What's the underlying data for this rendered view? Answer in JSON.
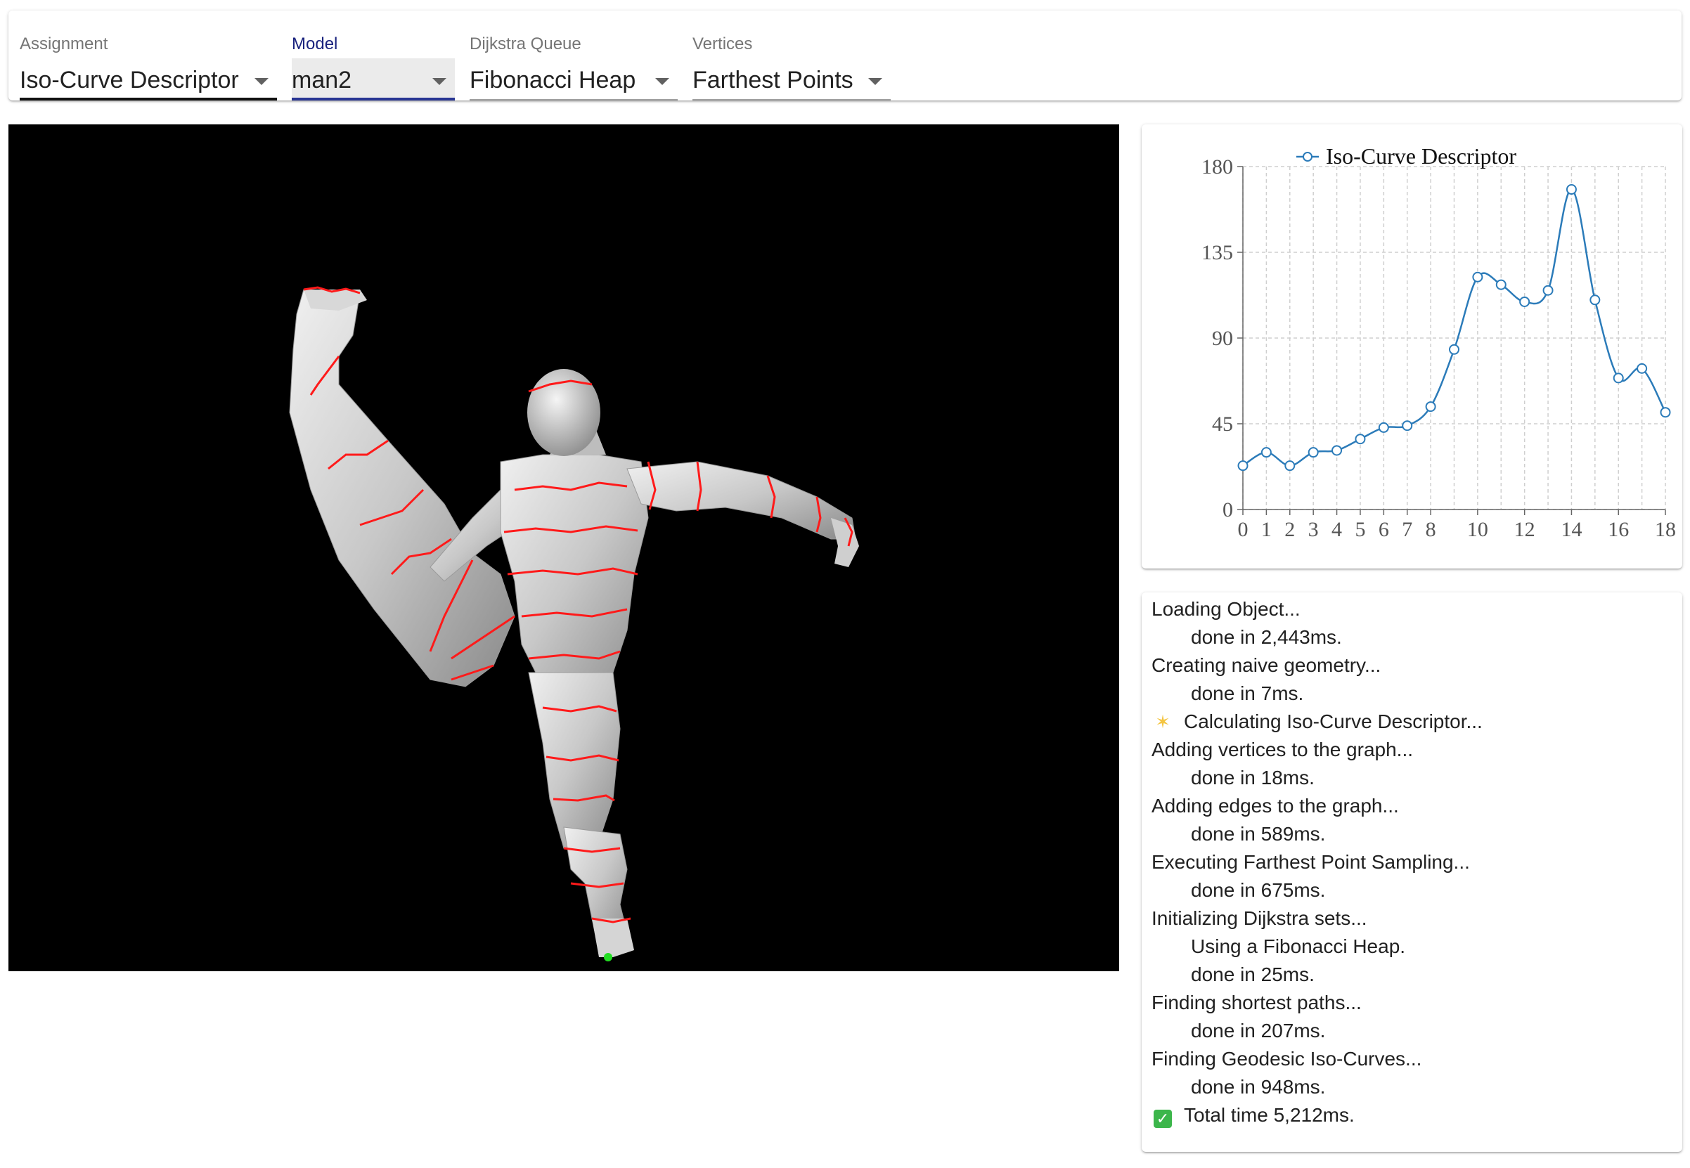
{
  "toolbar": {
    "assignment": {
      "label": "Assignment",
      "value": "Iso-Curve Descriptor"
    },
    "model": {
      "label": "Model",
      "value": "man2"
    },
    "queue": {
      "label": "Dijkstra Queue",
      "value": "Fibonacci Heap"
    },
    "vertices": {
      "label": "Vertices",
      "value": "Farthest Points"
    }
  },
  "viewport": {
    "background": "#000000",
    "mesh_color": "#d9d9d9",
    "curve_color": "#ff1a1a",
    "source_point_color": "#22dd22",
    "model_name": "man2"
  },
  "chart_data": {
    "type": "line",
    "series": [
      {
        "name": "Iso-Curve Descriptor",
        "color": "#2b7bb9",
        "x": [
          0,
          1,
          2,
          3,
          4,
          5,
          6,
          7,
          8,
          9,
          10,
          11,
          12,
          13,
          14,
          15,
          16,
          17,
          18
        ],
        "y": [
          23,
          30,
          23,
          30,
          31,
          37,
          43,
          44,
          54,
          84,
          122,
          118,
          109,
          115,
          168,
          110,
          69,
          74,
          51
        ]
      }
    ],
    "legend_position": "top",
    "grid": true,
    "xlim": [
      0,
      18
    ],
    "ylim": [
      0,
      180
    ],
    "x_ticks": [
      "0",
      "1",
      "2",
      "3",
      "4",
      "5",
      "6",
      "7",
      "8",
      "10",
      "12",
      "14",
      "16",
      "18"
    ],
    "x_tick_values": [
      0,
      1,
      2,
      3,
      4,
      5,
      6,
      7,
      8,
      10,
      12,
      14,
      16,
      18
    ],
    "y_ticks": [
      "0",
      "45",
      "90",
      "135",
      "180"
    ],
    "y_tick_values": [
      0,
      45,
      90,
      135,
      180
    ]
  },
  "log": [
    {
      "text": "Loading Object...",
      "indent": false,
      "icon": ""
    },
    {
      "text": "done in 2,443ms.",
      "indent": true,
      "icon": ""
    },
    {
      "text": "Creating naive geometry...",
      "indent": false,
      "icon": ""
    },
    {
      "text": "done in 7ms.",
      "indent": true,
      "icon": ""
    },
    {
      "text": "Calculating Iso-Curve Descriptor...",
      "indent": false,
      "icon": "sparkle"
    },
    {
      "text": "Adding vertices to the graph...",
      "indent": false,
      "icon": ""
    },
    {
      "text": "done in 18ms.",
      "indent": true,
      "icon": ""
    },
    {
      "text": "Adding edges to the graph...",
      "indent": false,
      "icon": ""
    },
    {
      "text": "done in 589ms.",
      "indent": true,
      "icon": ""
    },
    {
      "text": "Executing Farthest Point Sampling...",
      "indent": false,
      "icon": ""
    },
    {
      "text": "done in 675ms.",
      "indent": true,
      "icon": ""
    },
    {
      "text": "Initializing Dijkstra sets...",
      "indent": false,
      "icon": ""
    },
    {
      "text": "Using a Fibonacci Heap.",
      "indent": true,
      "icon": ""
    },
    {
      "text": "done in 25ms.",
      "indent": true,
      "icon": ""
    },
    {
      "text": "Finding shortest paths...",
      "indent": false,
      "icon": ""
    },
    {
      "text": "done in 207ms.",
      "indent": true,
      "icon": ""
    },
    {
      "text": "Finding Geodesic Iso-Curves...",
      "indent": false,
      "icon": ""
    },
    {
      "text": "done in 948ms.",
      "indent": true,
      "icon": ""
    },
    {
      "text": "Total time 5,212ms.",
      "indent": false,
      "icon": "check"
    }
  ]
}
